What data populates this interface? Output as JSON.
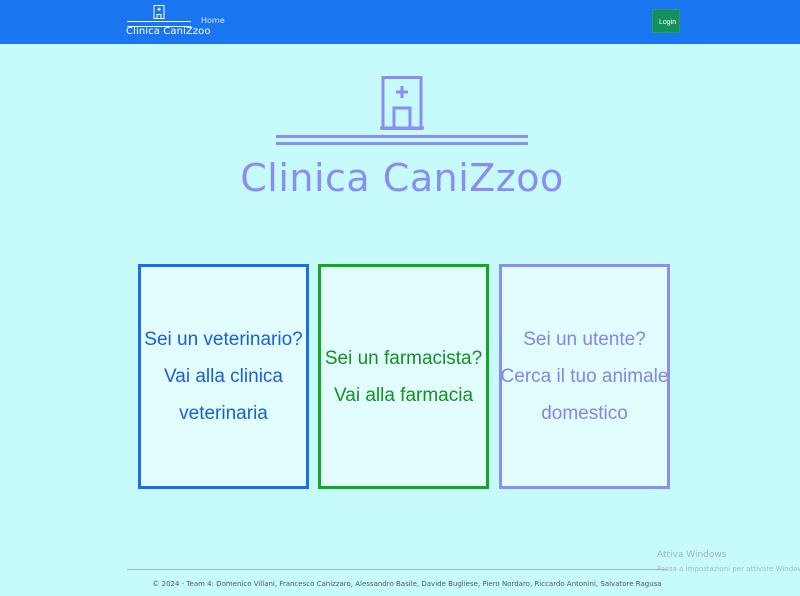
{
  "navbar": {
    "brand_name": "Clinica CaniZzoo",
    "home_label": "Home",
    "login_label": "Login"
  },
  "hero": {
    "title": "Clinica CaniZzoo"
  },
  "cards": [
    {
      "line1": "Sei un veterinario?",
      "line2": "Vai alla clinica",
      "line3": "veterinaria"
    },
    {
      "line1": "Sei un farmacista?",
      "line2": "Vai alla farmacia"
    },
    {
      "line1": "Sei un utente?",
      "line2": "Cerca il tuo animale",
      "line3": "domestico"
    }
  ],
  "footer": {
    "text": "© 2024 - Team 4: Domenico Villani, Francesco Canizzaro, Alessandro Basile, Davide Bugliese, Piero Nordaro, Riccardo Antonini, Salvatore Ragusa"
  },
  "watermark": {
    "title": "Attiva Windows",
    "subtitle": "Passa a Impostazioni per attivare Windows."
  },
  "colors": {
    "navbar": "#1976f0",
    "background": "#c7fbfb",
    "accent_purple": "#8b8cf4",
    "vet_blue": "#1a6cf0",
    "pharmacy_green": "#12a824",
    "login_green": "#14915a"
  }
}
